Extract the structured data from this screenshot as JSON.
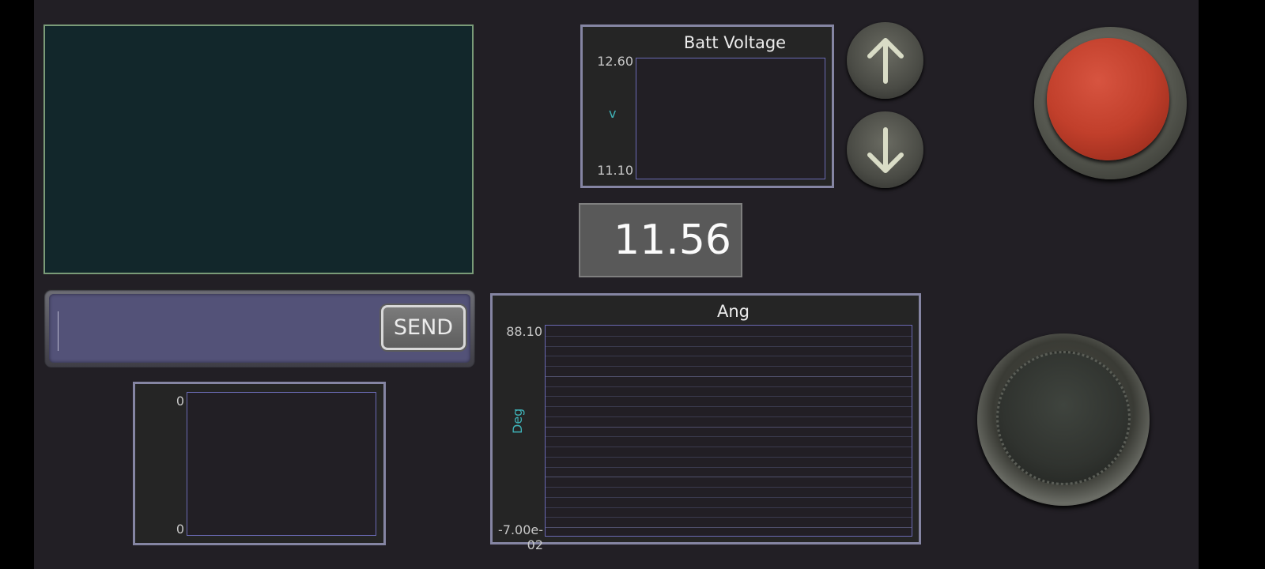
{
  "command": {
    "input_value": "",
    "send_label": "SEND"
  },
  "batt_chart": {
    "title": "Batt Voltage",
    "y_max": "12.60",
    "y_min": "11.10",
    "unit": "v"
  },
  "batt_value": "11.56",
  "small_chart": {
    "y_max": "0",
    "y_min": "0"
  },
  "ang_chart": {
    "title": "Ang",
    "y_max": "88.10",
    "y_min": "-7.00e-02",
    "unit": "Deg"
  },
  "colors": {
    "terminal_bg": "#12272b",
    "emergency_red": "#c9412d",
    "axis_label": "#3fb3b8"
  },
  "icons": [
    "arrow-up-icon",
    "arrow-down-icon"
  ]
}
